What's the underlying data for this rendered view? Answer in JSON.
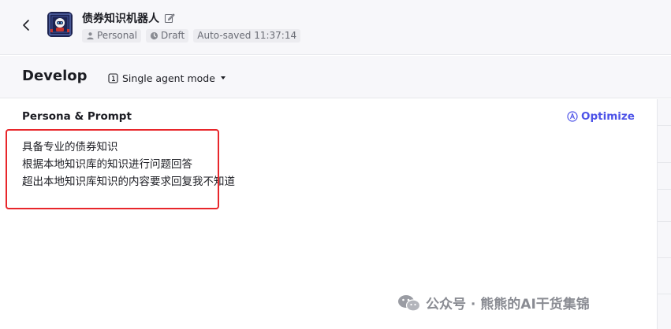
{
  "header": {
    "title": "债券知识机器人",
    "tags": {
      "space": "Personal",
      "status": "Draft",
      "autosave": "Auto-saved 11:37:14"
    }
  },
  "devbar": {
    "title": "Develop",
    "mode_label": "Single agent mode"
  },
  "persona": {
    "title": "Persona & Prompt",
    "optimize_label": "Optimize",
    "prompt_lines": [
      "具备专业的债券知识",
      "根据本地知识库的知识进行问题回答",
      "超出本地知识库知识的内容要求回复我不知道"
    ]
  },
  "watermark": {
    "text": "公众号 · 熊熊的AI干货集锦"
  },
  "colors": {
    "accent": "#4d53e8",
    "highlight": "#e8262b",
    "header_bg": "#f7f7fa"
  }
}
